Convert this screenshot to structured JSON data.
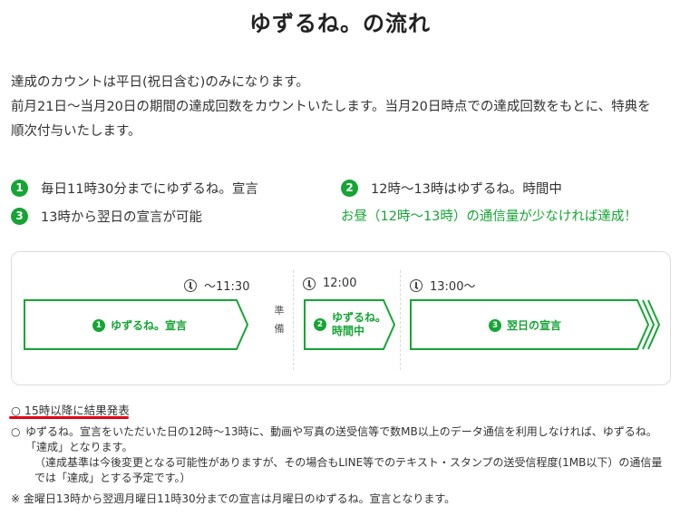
{
  "page": {
    "title": "ゆずるね。の流れ"
  },
  "intro": {
    "line1": "達成のカウントは平日(祝日含む)のみになります。",
    "line2": "前月21日〜当月20日の期間の達成回数をカウントいたします。当月20日時点での達成回数をもとに、特典を順次付与いたします。"
  },
  "steps": [
    {
      "num": "1",
      "text": "毎日11時30分までにゆずるね。宣言"
    },
    {
      "num": "2",
      "text": "12時〜13時はゆずるね。時間中"
    },
    {
      "num": "3",
      "text": "13時から翌日の宣言が可能"
    }
  ],
  "green_note": "お昼（12時〜13時）の通信量が少なければ達成！",
  "timeline": {
    "times": [
      "〜11:30",
      "12:00",
      "13:00〜"
    ],
    "prep": [
      "準",
      "備"
    ],
    "labels": [
      {
        "num": "1",
        "text": "ゆずるね。宣言"
      },
      {
        "num": "2",
        "line1": "ゆずるね。",
        "line2": "時間中"
      },
      {
        "num": "3",
        "text": "翌日の宣言"
      }
    ],
    "accent_color": "#16a535"
  },
  "result": {
    "heading": "○ 15時以降に結果発表",
    "mark": "○",
    "note_main": "ゆずるね。宣言をいただいた日の12時〜13時に、動画や写真の送受信等で数MB以上のデータ通信を利用しなければ、ゆずるね。「達成」となります。",
    "note_sub": "（達成基準は今後変更となる可能性がありますが、その場合もLINE等でのテキスト・スタンプの送受信程度(1MB以下）の通信量では「達成」とする予定です。）",
    "footnote": "※ 金曜日13時から翌週月曜日11時30分までの宣言は月曜日のゆずるね。宣言となります。"
  }
}
